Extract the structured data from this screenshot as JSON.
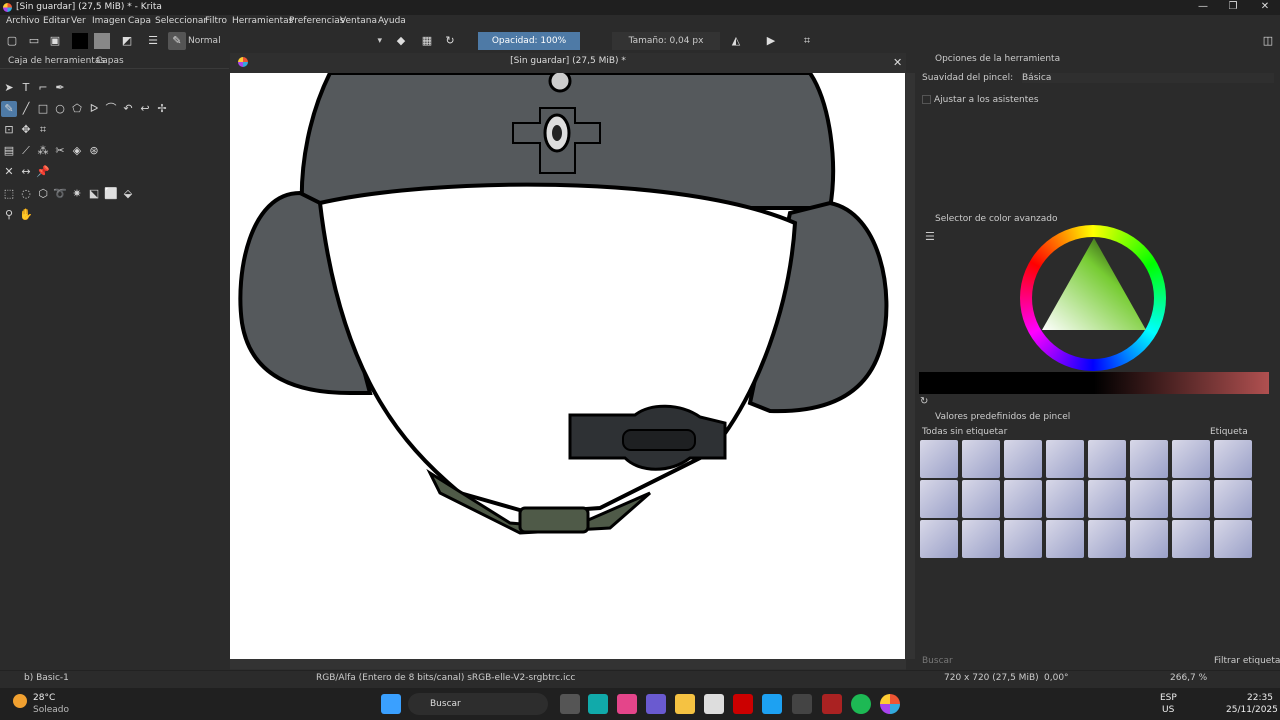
{
  "window": {
    "title": "[Sin guardar]  (27,5 MiB) * - Krita",
    "minimize": "—",
    "maximize": "❐",
    "close": "✕"
  },
  "menu": [
    "Archivo",
    "Editar",
    "Ver",
    "Imagen",
    "Capa",
    "Seleccionar",
    "Filtro",
    "Herramientas",
    "Preferencias",
    "Ventana",
    "Ayuda"
  ],
  "toolbar": {
    "blend_mode": "Normal",
    "opacity": "Opacidad: 100%",
    "size": "Tamaño: 0,04 px"
  },
  "left_tabs": [
    "Caja de herramientas",
    "Capas"
  ],
  "document": {
    "title": "[Sin guardar]  (27,5 MiB) *"
  },
  "tool_options": {
    "header": "Opciones de la herramienta",
    "smoothing_label": "Suavidad del pincel:",
    "smoothing_value": "Básica",
    "snap_label": "Ajustar a los asistentes"
  },
  "color_selector": {
    "header": "Selector de color avanzado"
  },
  "brush_presets": {
    "header": "Valores predefinidos de pincel",
    "tag_filter": "Todas sin etiquetar",
    "tag_label": "Etiqueta",
    "search_placeholder": "Buscar",
    "filter_tag": "Filtrar etiqueta"
  },
  "status": {
    "brush": "b) Basic-1",
    "color_profile": "RGB/Alfa (Entero de 8 bits/canal)  sRGB-elle-V2-srgbtrc.icc",
    "image_size": "720 x 720 (27,5 MiB)",
    "rotation": "0,00°",
    "zoom": "266,7 %"
  },
  "taskbar": {
    "weather_temp": "28°C",
    "weather_desc": "Soleado",
    "search": "Buscar",
    "lang": "ESP",
    "region": "US",
    "time": "22:35",
    "date": "25/11/2025"
  },
  "colors": {
    "accent": "#4e7aa6",
    "helmet": "#55595c",
    "mic": "#2e3134",
    "strap": "#4f5a48"
  }
}
